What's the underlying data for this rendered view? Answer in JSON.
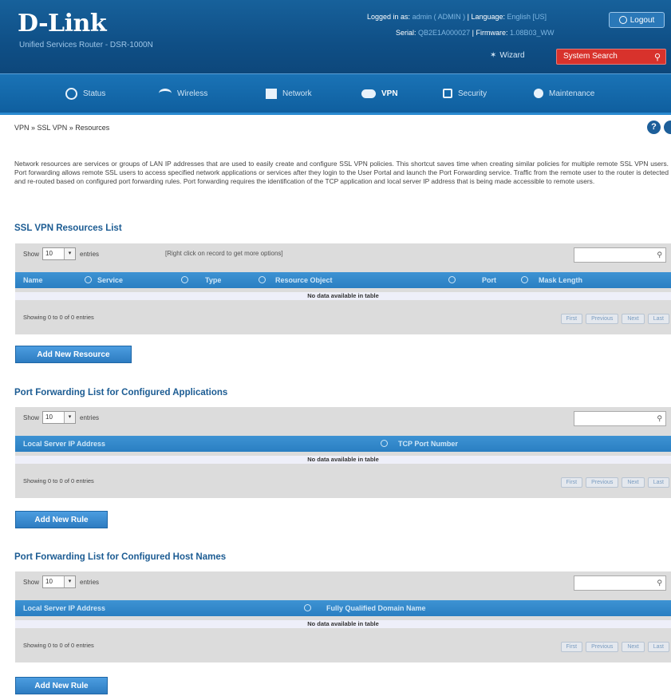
{
  "header": {
    "brand": "D-Link",
    "model": "Unified Services Router - DSR-1000N",
    "logged_in_label": "Logged in as:",
    "logged_in_value": "admin ( ADMIN )",
    "language_label": "Language:",
    "language_value": "English [US]",
    "serial_label": "Serial:",
    "serial_value": "QB2E1A000027",
    "firmware_label": "Firmware:",
    "firmware_value": "1.08B03_WW",
    "logout_label": "Logout",
    "wizard_label": "Wizard",
    "system_search_label": "System Search"
  },
  "nav": {
    "items": [
      {
        "label": "Status",
        "icon": "gauge-icon"
      },
      {
        "label": "Wireless",
        "icon": "wifi-icon"
      },
      {
        "label": "Network",
        "icon": "network-icon"
      },
      {
        "label": "VPN",
        "icon": "cloud-icon"
      },
      {
        "label": "Security",
        "icon": "lock-icon"
      },
      {
        "label": "Maintenance",
        "icon": "gear-icon"
      }
    ],
    "active": "VPN"
  },
  "breadcrumb": "VPN » SSL VPN » Resources",
  "description": "Network resources are services or groups of LAN IP addresses that are used to easily create and configure SSL VPN policies. This shortcut saves time when creating similar policies for multiple remote SSL VPN users. Port forwarding allows remote SSL users to access specified network applications or services after they login to the User Portal and launch the Port Forwarding service. Traffic from the remote user to the router is detected and re-routed based on configured port forwarding rules. Port forwarding requires the identification of the TCP application and local server IP address that is being made accessible to remote users.",
  "show_label": "Show",
  "show_value": "10",
  "entries_label": "entries",
  "pager": {
    "first": "First",
    "previous": "Previous",
    "next": "Next",
    "last": "Last"
  },
  "no_data": "No data available in table",
  "showing_text": "Showing 0 to 0 of 0 entries",
  "resources": {
    "title": "SSL VPN Resources List",
    "hint": "[Right click on record to get more options]",
    "columns": [
      "Name",
      "Service",
      "Type",
      "Resource Object",
      "Port",
      "Mask Length"
    ],
    "add_button": "Add New Resource"
  },
  "apps": {
    "title": "Port Forwarding List for Configured Applications",
    "columns": [
      "Local Server IP Address",
      "TCP Port Number"
    ],
    "add_button": "Add New Rule"
  },
  "hosts": {
    "title": "Port Forwarding List for Configured Host Names",
    "columns": [
      "Local Server IP Address",
      "Fully Qualified Domain Name"
    ],
    "add_button": "Add New Rule"
  }
}
